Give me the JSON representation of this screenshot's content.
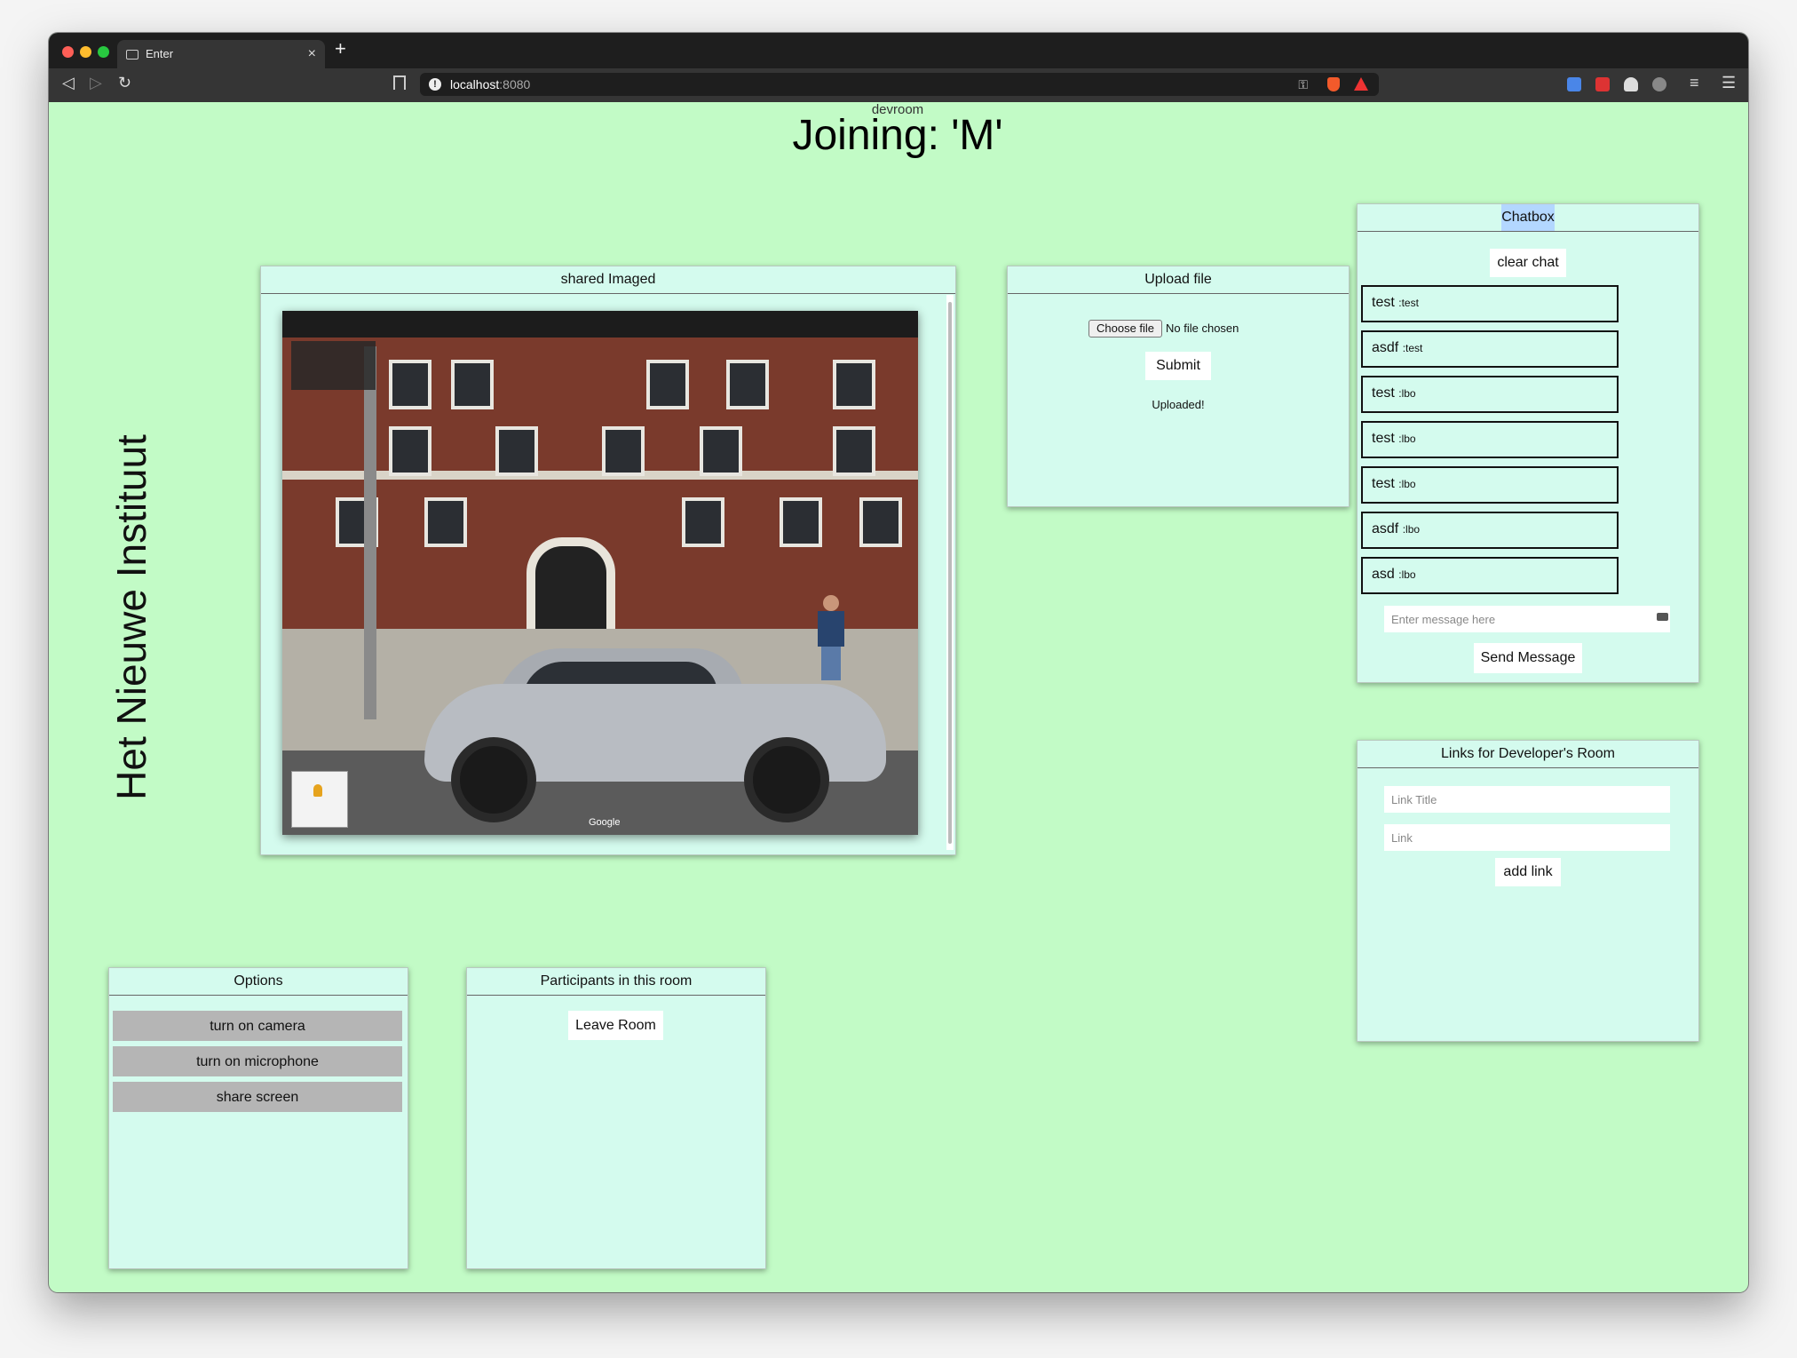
{
  "browser": {
    "tab_title": "Enter",
    "tab_close": "×",
    "new_tab": "+",
    "url_host": "localhost",
    "url_port": ":8080"
  },
  "header": {
    "room_name": "devroom",
    "joining": "Joining: 'M'"
  },
  "brand": "Het Nieuwe Instituut",
  "shared_image": {
    "title": "shared Imaged",
    "google_mark": "Google"
  },
  "upload": {
    "title": "Upload file",
    "choose_file_label": "Choose file",
    "file_status": "No file chosen",
    "submit_label": "Submit",
    "status_message": "Uploaded!"
  },
  "chatbox": {
    "title": "Chatbox",
    "clear_label": "clear chat",
    "messages": [
      {
        "text": "test",
        "user": ":test"
      },
      {
        "text": "asdf",
        "user": ":test"
      },
      {
        "text": "test",
        "user": ":lbo"
      },
      {
        "text": "test",
        "user": ":lbo"
      },
      {
        "text": "test",
        "user": ":lbo"
      },
      {
        "text": "asdf",
        "user": ":lbo"
      },
      {
        "text": "asd",
        "user": ":lbo"
      }
    ],
    "input_placeholder": "Enter message here",
    "send_label": "Send Message"
  },
  "links": {
    "title": "Links for Developer's Room",
    "title_placeholder": "Link Title",
    "link_placeholder": "Link",
    "add_label": "add link"
  },
  "options": {
    "title": "Options",
    "camera_label": "turn on camera",
    "mic_label": "turn on microphone",
    "share_label": "share screen"
  },
  "participants": {
    "title": "Participants in this room",
    "leave_label": "Leave Room"
  }
}
